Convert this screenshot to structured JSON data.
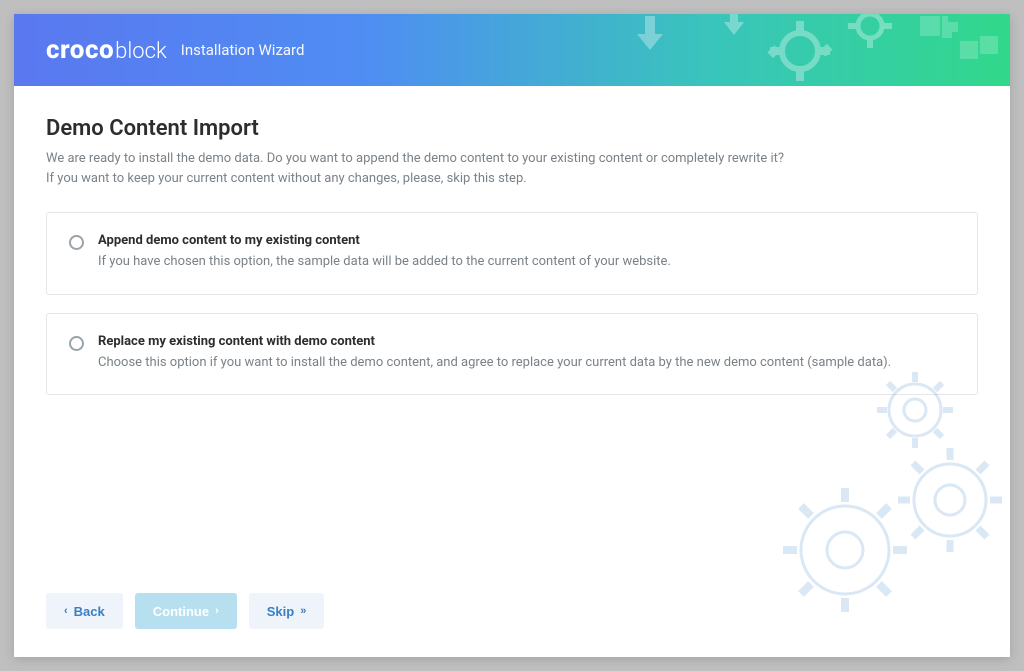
{
  "header": {
    "logo_bold": "croco",
    "logo_light": "block",
    "subtitle": "Installation Wizard"
  },
  "page": {
    "title": "Demo Content Import",
    "description_line1": "We are ready to install the demo data. Do you want to append the demo content to your existing content or completely rewrite it?",
    "description_line2": "If you want to keep your current content without any changes, please, skip this step."
  },
  "options": [
    {
      "title": "Append demo content to my existing content",
      "description": "If you have chosen this option, the sample data will be added to the current content of your website."
    },
    {
      "title": "Replace my existing content with demo content",
      "description": "Choose this option if you want to install the demo content, and agree to replace your current data by the new demo content (sample data)."
    }
  ],
  "buttons": {
    "back": "Back",
    "continue": "Continue",
    "skip": "Skip"
  }
}
